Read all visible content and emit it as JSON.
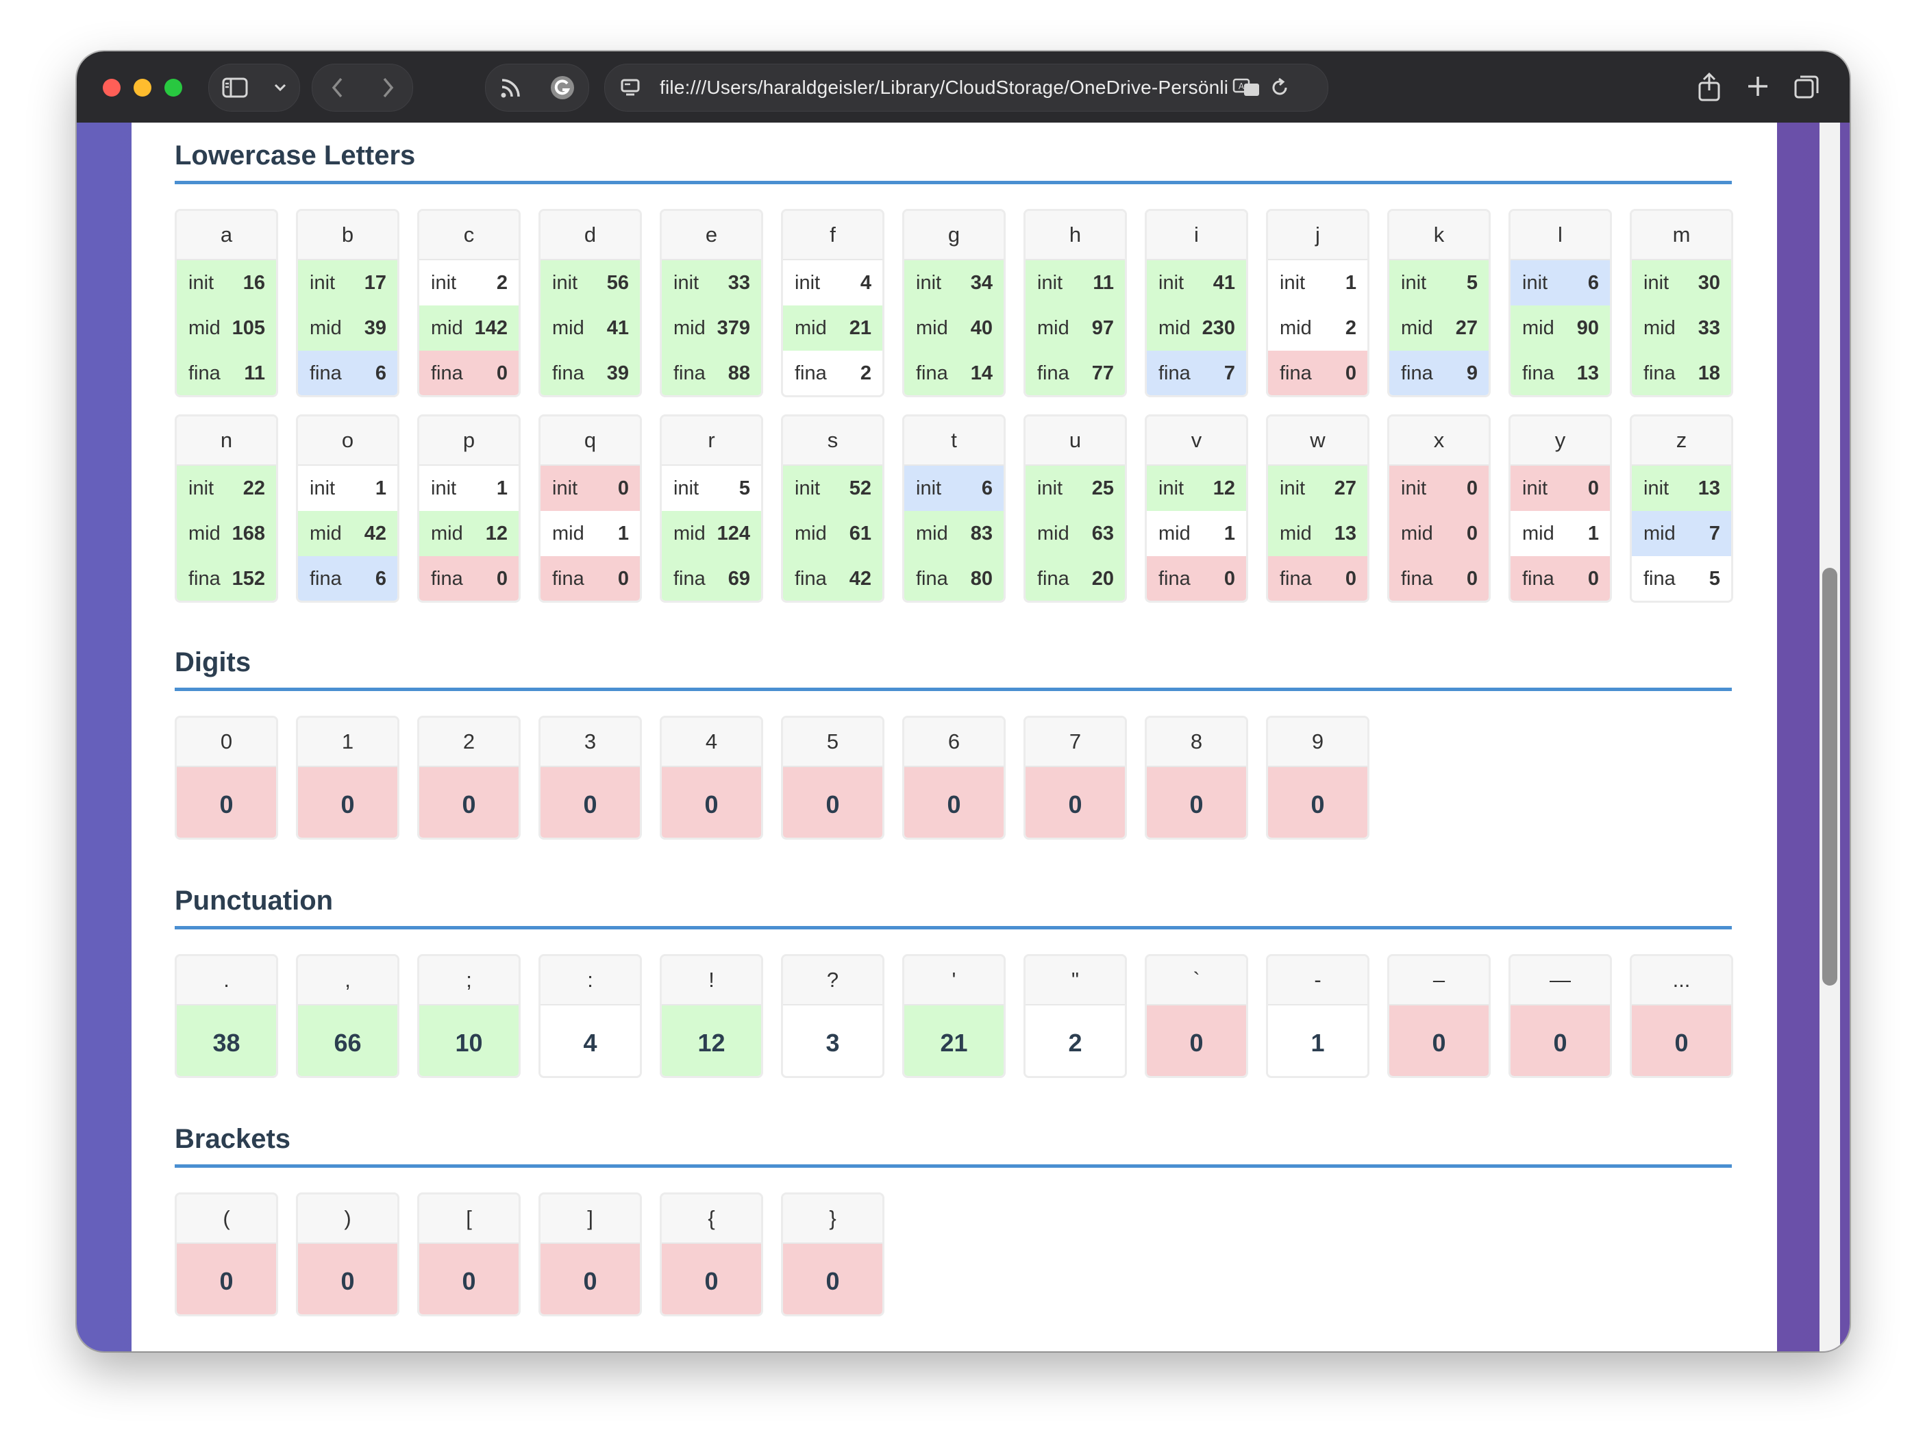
{
  "browser": {
    "url": "file:///Users/haraldgeisler/Library/CloudStorage/OneDrive-Persönlich/",
    "icons": [
      "sidebar-icon",
      "chevron-down-icon",
      "back-icon",
      "forward-icon",
      "rss-icon",
      "grammarly-icon",
      "page-settings-icon",
      "translate-icon",
      "reload-icon",
      "share-icon",
      "new-tab-icon",
      "tab-overview-icon"
    ]
  },
  "colors": {
    "green": "#d6fad1",
    "blue": "#d4e4fb",
    "red": "#f7d0d2",
    "white": "#ffffff",
    "accent": "#4a8fd1"
  },
  "lowercase": {
    "title": "Lowercase Letters",
    "labels": {
      "init": "init",
      "mid": "mid",
      "fina": "fina"
    },
    "letters": [
      {
        "char": "a",
        "init": "16",
        "mid": "105",
        "fina": "11",
        "status": [
          "g",
          "g",
          "g"
        ]
      },
      {
        "char": "b",
        "init": "17",
        "mid": "39",
        "fina": "6",
        "status": [
          "g",
          "g",
          "b"
        ]
      },
      {
        "char": "c",
        "init": "2",
        "mid": "142",
        "fina": "0",
        "status": [
          "w",
          "g",
          "r"
        ]
      },
      {
        "char": "d",
        "init": "56",
        "mid": "41",
        "fina": "39",
        "status": [
          "g",
          "g",
          "g"
        ]
      },
      {
        "char": "e",
        "init": "33",
        "mid": "379",
        "fina": "88",
        "status": [
          "g",
          "g",
          "g"
        ]
      },
      {
        "char": "f",
        "init": "4",
        "mid": "21",
        "fina": "2",
        "status": [
          "w",
          "g",
          "w"
        ]
      },
      {
        "char": "g",
        "init": "34",
        "mid": "40",
        "fina": "14",
        "status": [
          "g",
          "g",
          "g"
        ]
      },
      {
        "char": "h",
        "init": "11",
        "mid": "97",
        "fina": "77",
        "status": [
          "g",
          "g",
          "g"
        ]
      },
      {
        "char": "i",
        "init": "41",
        "mid": "230",
        "fina": "7",
        "status": [
          "g",
          "g",
          "b"
        ]
      },
      {
        "char": "j",
        "init": "1",
        "mid": "2",
        "fina": "0",
        "status": [
          "w",
          "w",
          "r"
        ]
      },
      {
        "char": "k",
        "init": "5",
        "mid": "27",
        "fina": "9",
        "status": [
          "g",
          "g",
          "b"
        ]
      },
      {
        "char": "l",
        "init": "6",
        "mid": "90",
        "fina": "13",
        "status": [
          "b",
          "g",
          "g"
        ]
      },
      {
        "char": "m",
        "init": "30",
        "mid": "33",
        "fina": "18",
        "status": [
          "g",
          "g",
          "g"
        ]
      },
      {
        "char": "n",
        "init": "22",
        "mid": "168",
        "fina": "152",
        "status": [
          "g",
          "g",
          "g"
        ]
      },
      {
        "char": "o",
        "init": "1",
        "mid": "42",
        "fina": "6",
        "status": [
          "w",
          "g",
          "b"
        ]
      },
      {
        "char": "p",
        "init": "1",
        "mid": "12",
        "fina": "0",
        "status": [
          "w",
          "g",
          "r"
        ]
      },
      {
        "char": "q",
        "init": "0",
        "mid": "1",
        "fina": "0",
        "status": [
          "r",
          "w",
          "r"
        ]
      },
      {
        "char": "r",
        "init": "5",
        "mid": "124",
        "fina": "69",
        "status": [
          "w",
          "g",
          "g"
        ]
      },
      {
        "char": "s",
        "init": "52",
        "mid": "61",
        "fina": "42",
        "status": [
          "g",
          "g",
          "g"
        ]
      },
      {
        "char": "t",
        "init": "6",
        "mid": "83",
        "fina": "80",
        "status": [
          "b",
          "g",
          "g"
        ]
      },
      {
        "char": "u",
        "init": "25",
        "mid": "63",
        "fina": "20",
        "status": [
          "g",
          "g",
          "g"
        ]
      },
      {
        "char": "v",
        "init": "12",
        "mid": "1",
        "fina": "0",
        "status": [
          "g",
          "w",
          "r"
        ]
      },
      {
        "char": "w",
        "init": "27",
        "mid": "13",
        "fina": "0",
        "status": [
          "g",
          "g",
          "r"
        ]
      },
      {
        "char": "x",
        "init": "0",
        "mid": "0",
        "fina": "0",
        "status": [
          "r",
          "r",
          "r"
        ]
      },
      {
        "char": "y",
        "init": "0",
        "mid": "1",
        "fina": "0",
        "status": [
          "r",
          "w",
          "r"
        ]
      },
      {
        "char": "z",
        "init": "13",
        "mid": "7",
        "fina": "5",
        "status": [
          "g",
          "b",
          "w"
        ]
      }
    ]
  },
  "digits": {
    "title": "Digits",
    "items": [
      {
        "char": "0",
        "count": "0",
        "status": "r"
      },
      {
        "char": "1",
        "count": "0",
        "status": "r"
      },
      {
        "char": "2",
        "count": "0",
        "status": "r"
      },
      {
        "char": "3",
        "count": "0",
        "status": "r"
      },
      {
        "char": "4",
        "count": "0",
        "status": "r"
      },
      {
        "char": "5",
        "count": "0",
        "status": "r"
      },
      {
        "char": "6",
        "count": "0",
        "status": "r"
      },
      {
        "char": "7",
        "count": "0",
        "status": "r"
      },
      {
        "char": "8",
        "count": "0",
        "status": "r"
      },
      {
        "char": "9",
        "count": "0",
        "status": "r"
      }
    ]
  },
  "punctuation": {
    "title": "Punctuation",
    "items": [
      {
        "char": ".",
        "count": "38",
        "status": "g"
      },
      {
        "char": ",",
        "count": "66",
        "status": "g"
      },
      {
        "char": ";",
        "count": "10",
        "status": "g"
      },
      {
        "char": ":",
        "count": "4",
        "status": "w"
      },
      {
        "char": "!",
        "count": "12",
        "status": "g"
      },
      {
        "char": "?",
        "count": "3",
        "status": "w"
      },
      {
        "char": "'",
        "count": "21",
        "status": "g"
      },
      {
        "char": "\"",
        "count": "2",
        "status": "w"
      },
      {
        "char": "`",
        "count": "0",
        "status": "r"
      },
      {
        "char": "-",
        "count": "1",
        "status": "w"
      },
      {
        "char": "–",
        "count": "0",
        "status": "r"
      },
      {
        "char": "—",
        "count": "0",
        "status": "r"
      },
      {
        "char": "...",
        "count": "0",
        "status": "r"
      }
    ]
  },
  "brackets": {
    "title": "Brackets",
    "items": [
      {
        "char": "(",
        "count": "0",
        "status": "r"
      },
      {
        "char": ")",
        "count": "0",
        "status": "r"
      },
      {
        "char": "[",
        "count": "0",
        "status": "r"
      },
      {
        "char": "]",
        "count": "0",
        "status": "r"
      },
      {
        "char": "{",
        "count": "0",
        "status": "r"
      },
      {
        "char": "}",
        "count": "0",
        "status": "r"
      }
    ]
  }
}
